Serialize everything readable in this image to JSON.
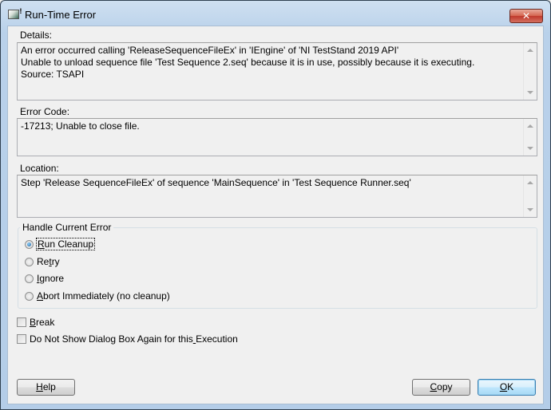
{
  "window": {
    "title": "Run-Time Error",
    "close_label": "✕"
  },
  "details": {
    "label": "Details:",
    "lines": [
      "An error occurred calling 'ReleaseSequenceFileEx' in 'IEngine' of 'NI TestStand 2019 API'",
      "Unable to unload sequence file 'Test Sequence 2.seq' because it is in use, possibly because it is executing.",
      "Source: TSAPI"
    ]
  },
  "error_code": {
    "label": "Error Code:",
    "value": "-17213; Unable to close file."
  },
  "location": {
    "label": "Location:",
    "value": "Step 'Release SequenceFileEx' of sequence 'MainSequence' in 'Test Sequence Runner.seq'"
  },
  "handle_error": {
    "title": "Handle Current Error",
    "options": [
      {
        "label": "Run Cleanup",
        "mnemonic_index": 0,
        "checked": true
      },
      {
        "label": "Retry",
        "mnemonic_index": 2,
        "checked": false
      },
      {
        "label": "Ignore",
        "mnemonic_index": 0,
        "checked": false
      },
      {
        "label": "Abort Immediately (no cleanup)",
        "mnemonic_index": 0,
        "checked": false
      }
    ]
  },
  "checkboxes": [
    {
      "label": "Break",
      "mnemonic_index": 0,
      "checked": false
    },
    {
      "label": "Do Not Show Dialog Box Again for this Execution",
      "mnemonic_index": 37,
      "checked": false
    }
  ],
  "buttons": {
    "help": {
      "label": "Help",
      "mnemonic_index": 0
    },
    "copy": {
      "label": "Copy",
      "mnemonic_index": 0
    },
    "ok": {
      "label": "OK",
      "mnemonic_index": 0
    }
  },
  "icons": {
    "app": "teststand-error-icon",
    "close": "close-icon",
    "scroll_up": "chevron-up-icon",
    "scroll_down": "chevron-down-icon"
  }
}
